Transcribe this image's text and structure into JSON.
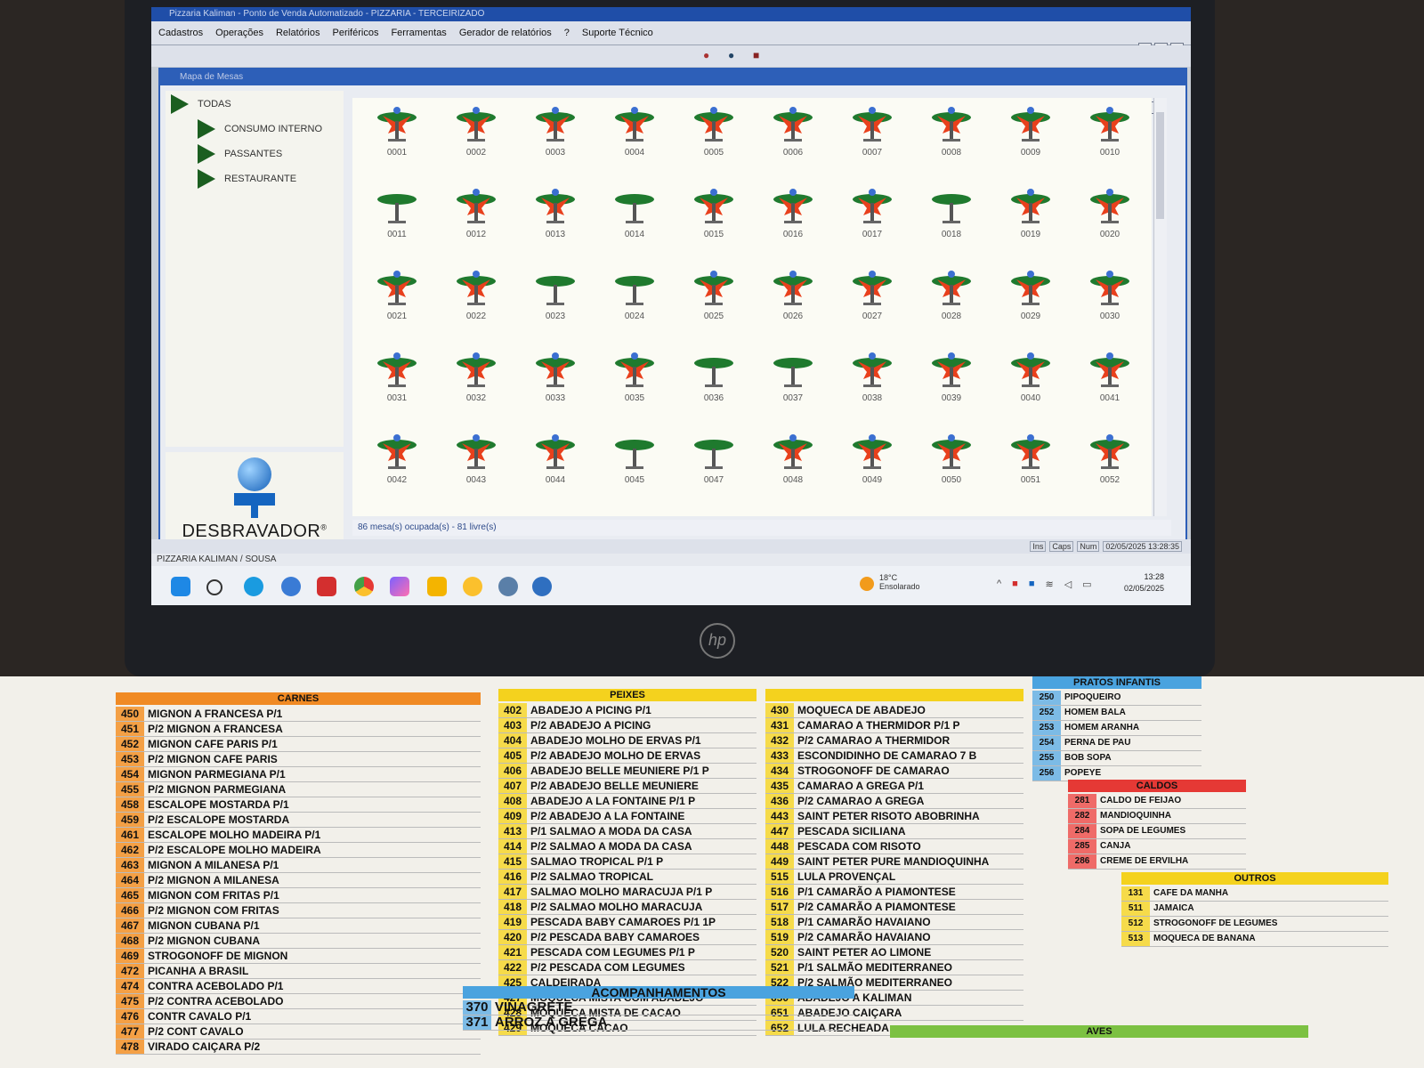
{
  "window": {
    "title": "Pizzaria Kaliman - Ponto de Venda Automatizado - PIZZARIA - TERCEIRIZADO",
    "menu": [
      "Cadastros",
      "Operações",
      "Relatórios",
      "Periféricos",
      "Ferramentas",
      "Gerador de relatórios",
      "?",
      "Suporte Técnico"
    ],
    "controls": [
      "_",
      "□",
      "×"
    ]
  },
  "inner_window": {
    "title": "Mapa de Mesas",
    "controls": [
      "_",
      "□",
      "×"
    ]
  },
  "categories": [
    "TODAS",
    "CONSUMO INTERNO",
    "PASSANTES",
    "RESTAURANTE"
  ],
  "logo": {
    "text": "DESBRAVADOR",
    "mark": "®"
  },
  "tables": [
    {
      "num": "0001",
      "status": "occupied"
    },
    {
      "num": "0002",
      "status": "occupied"
    },
    {
      "num": "0003",
      "status": "occupied"
    },
    {
      "num": "0004",
      "status": "occupied"
    },
    {
      "num": "0005",
      "status": "occupied"
    },
    {
      "num": "0006",
      "status": "occupied"
    },
    {
      "num": "0007",
      "status": "occupied"
    },
    {
      "num": "0008",
      "status": "occupied"
    },
    {
      "num": "0009",
      "status": "occupied"
    },
    {
      "num": "0010",
      "status": "occupied"
    },
    {
      "num": "0011",
      "status": "free"
    },
    {
      "num": "0012",
      "status": "occupied"
    },
    {
      "num": "0013",
      "status": "occupied"
    },
    {
      "num": "0014",
      "status": "free"
    },
    {
      "num": "0015",
      "status": "occupied"
    },
    {
      "num": "0016",
      "status": "occupied"
    },
    {
      "num": "0017",
      "status": "occupied"
    },
    {
      "num": "0018",
      "status": "free"
    },
    {
      "num": "0019",
      "status": "occupied"
    },
    {
      "num": "0020",
      "status": "occupied"
    },
    {
      "num": "0021",
      "status": "occupied"
    },
    {
      "num": "0022",
      "status": "occupied"
    },
    {
      "num": "0023",
      "status": "free"
    },
    {
      "num": "0024",
      "status": "free"
    },
    {
      "num": "0025",
      "status": "occupied"
    },
    {
      "num": "0026",
      "status": "occupied"
    },
    {
      "num": "0027",
      "status": "occupied"
    },
    {
      "num": "0028",
      "status": "occupied"
    },
    {
      "num": "0029",
      "status": "occupied"
    },
    {
      "num": "0030",
      "status": "occupied"
    },
    {
      "num": "0031",
      "status": "occupied"
    },
    {
      "num": "0032",
      "status": "occupied"
    },
    {
      "num": "0033",
      "status": "occupied"
    },
    {
      "num": "0035",
      "status": "occupied"
    },
    {
      "num": "0036",
      "status": "free"
    },
    {
      "num": "0037",
      "status": "free"
    },
    {
      "num": "0038",
      "status": "occupied"
    },
    {
      "num": "0039",
      "status": "occupied"
    },
    {
      "num": "0040",
      "status": "occupied"
    },
    {
      "num": "0041",
      "status": "occupied"
    },
    {
      "num": "0042",
      "status": "occupied"
    },
    {
      "num": "0043",
      "status": "occupied"
    },
    {
      "num": "0044",
      "status": "occupied"
    },
    {
      "num": "0045",
      "status": "free"
    },
    {
      "num": "0047",
      "status": "free"
    },
    {
      "num": "0048",
      "status": "occupied"
    },
    {
      "num": "0049",
      "status": "occupied"
    },
    {
      "num": "0050",
      "status": "occupied"
    },
    {
      "num": "0051",
      "status": "occupied"
    },
    {
      "num": "0052",
      "status": "occupied"
    }
  ],
  "status_bar": "86 mesa(s) ocupada(s) - 81 livre(s)",
  "app_status": {
    "indicators": [
      "Ins",
      "Caps",
      "Num"
    ],
    "datetime": "02/05/2025 13:28:35"
  },
  "footer": "PIZZARIA KALIMAN / SOUSA",
  "taskbar": {
    "weather_temp": "18°C",
    "weather_desc": "Ensolarado",
    "time": "13:28",
    "date": "02/05/2025"
  },
  "laptop_brand": "hp",
  "colors": {
    "occupied": "#e8401c",
    "free": "#1f7a2e",
    "titlebar": "#1f4ea8"
  },
  "menu_card": {
    "carnes": {
      "header": "CARNES",
      "items": [
        {
          "code": "450",
          "name": "MIGNON A FRANCESA P/1"
        },
        {
          "code": "451",
          "name": "P/2 MIGNON A FRANCESA"
        },
        {
          "code": "452",
          "name": "MIGNON CAFE PARIS P/1"
        },
        {
          "code": "453",
          "name": "P/2 MIGNON CAFE PARIS"
        },
        {
          "code": "454",
          "name": "MIGNON PARMEGIANA P/1"
        },
        {
          "code": "455",
          "name": "P/2 MIGNON PARMEGIANA"
        },
        {
          "code": "458",
          "name": "ESCALOPE MOSTARDA P/1"
        },
        {
          "code": "459",
          "name": "P/2 ESCALOPE MOSTARDA"
        },
        {
          "code": "461",
          "name": "ESCALOPE MOLHO MADEIRA P/1"
        },
        {
          "code": "462",
          "name": "P/2 ESCALOPE MOLHO MADEIRA"
        },
        {
          "code": "463",
          "name": "MIGNON A MILANESA P/1"
        },
        {
          "code": "464",
          "name": "P/2 MIGNON A MILANESA"
        },
        {
          "code": "465",
          "name": "MIGNON COM FRITAS P/1"
        },
        {
          "code": "466",
          "name": "P/2 MIGNON COM FRITAS"
        },
        {
          "code": "467",
          "name": "MIGNON CUBANA P/1"
        },
        {
          "code": "468",
          "name": "P/2 MIGNON CUBANA"
        },
        {
          "code": "469",
          "name": "STROGONOFF DE MIGNON"
        },
        {
          "code": "472",
          "name": "PICANHA A BRASIL"
        },
        {
          "code": "474",
          "name": "CONTRA ACEBOLADO P/1"
        },
        {
          "code": "475",
          "name": "P/2 CONTRA ACEBOLADO"
        },
        {
          "code": "476",
          "name": "CONTR CAVALO P/1"
        },
        {
          "code": "477",
          "name": "P/2 CONT CAVALO"
        },
        {
          "code": "478",
          "name": "VIRADO CAIÇARA P/2"
        }
      ]
    },
    "peixes": {
      "header": "PEIXES",
      "left": [
        {
          "code": "402",
          "name": "ABADEJO A PICING P/1"
        },
        {
          "code": "403",
          "name": "P/2 ABADEJO A PICING"
        },
        {
          "code": "404",
          "name": "ABADEJO MOLHO DE ERVAS P/1"
        },
        {
          "code": "405",
          "name": "P/2 ABADEJO MOLHO DE ERVAS"
        },
        {
          "code": "406",
          "name": "ABADEJO BELLE MEUNIERE P/1 P"
        },
        {
          "code": "407",
          "name": "P/2 ABADEJO BELLE MEUNIERE"
        },
        {
          "code": "408",
          "name": "ABADEJO A LA FONTAINE P/1 P"
        },
        {
          "code": "409",
          "name": "P/2 ABADEJO A LA FONTAINE"
        },
        {
          "code": "413",
          "name": "P/1 SALMAO A MODA DA CASA"
        },
        {
          "code": "414",
          "name": "P/2 SALMAO A MODA DA CASA"
        },
        {
          "code": "415",
          "name": "SALMAO TROPICAL P/1 P"
        },
        {
          "code": "416",
          "name": "P/2 SALMAO TROPICAL"
        },
        {
          "code": "417",
          "name": "SALMAO MOLHO MARACUJA P/1 P"
        },
        {
          "code": "418",
          "name": "P/2 SALMAO MOLHO MARACUJA"
        },
        {
          "code": "419",
          "name": "PESCADA BABY CAMAROES P/1 1P"
        },
        {
          "code": "420",
          "name": "P/2 PESCADA BABY CAMAROES"
        },
        {
          "code": "421",
          "name": "PESCADA COM LEGUMES P/1 P"
        },
        {
          "code": "422",
          "name": "P/2 PESCADA COM LEGUMES"
        },
        {
          "code": "425",
          "name": "CALDEIRADA"
        },
        {
          "code": "427",
          "name": "MOQUECA MISTA COM ABADEJO"
        },
        {
          "code": "428",
          "name": "MOQUECA MISTA DE CACAO"
        },
        {
          "code": "429",
          "name": "MOQUECA CACAO"
        }
      ],
      "right": [
        {
          "code": "430",
          "name": "MOQUECA DE ABADEJO"
        },
        {
          "code": "431",
          "name": "CAMARAO A THERMIDOR P/1 P"
        },
        {
          "code": "432",
          "name": "P/2 CAMARAO A THERMIDOR"
        },
        {
          "code": "433",
          "name": "ESCONDIDINHO DE CAMARAO 7 B"
        },
        {
          "code": "434",
          "name": "STROGONOFF DE CAMARAO"
        },
        {
          "code": "435",
          "name": "CAMARAO A GREGA P/1"
        },
        {
          "code": "436",
          "name": "P/2 CAMARAO A GREGA"
        },
        {
          "code": "443",
          "name": "SAINT PETER RISOTO ABOBRINHA"
        },
        {
          "code": "447",
          "name": "PESCADA SICILIANA"
        },
        {
          "code": "448",
          "name": "PESCADA COM RISOTO"
        },
        {
          "code": "449",
          "name": "SAINT PETER PURE MANDIOQUINHA"
        },
        {
          "code": "515",
          "name": "LULA PROVENÇAL"
        },
        {
          "code": "516",
          "name": "P/1 CAMARÃO A PIAMONTESE"
        },
        {
          "code": "517",
          "name": "P/2 CAMARÃO A PIAMONTESE"
        },
        {
          "code": "518",
          "name": "P/1 CAMARÃO HAVAIANO"
        },
        {
          "code": "519",
          "name": "P/2 CAMARÃO HAVAIANO"
        },
        {
          "code": "520",
          "name": "SAINT PETER AO LIMONE"
        },
        {
          "code": "521",
          "name": "P/1 SALMÃO MEDITERRANEO"
        },
        {
          "code": "522",
          "name": "P/2 SALMÃO MEDITERRANEO"
        },
        {
          "code": "650",
          "name": "ABADEJO A KALIMAN"
        },
        {
          "code": "651",
          "name": "ABADEJO CAIÇARA"
        },
        {
          "code": "652",
          "name": "LULA RECHEADA"
        }
      ]
    },
    "pratos_infantis": {
      "header": "PRATOS INFANTIS",
      "items": [
        {
          "code": "250",
          "name": "PIPOQUEIRO"
        },
        {
          "code": "252",
          "name": "HOMEM BALA"
        },
        {
          "code": "253",
          "name": "HOMEM ARANHA"
        },
        {
          "code": "254",
          "name": "PERNA DE PAU"
        },
        {
          "code": "255",
          "name": "BOB SOPA"
        },
        {
          "code": "256",
          "name": "POPEYE"
        }
      ]
    },
    "caldos": {
      "header": "CALDOS",
      "items": [
        {
          "code": "281",
          "name": "CALDO DE FEIJAO"
        },
        {
          "code": "282",
          "name": "MANDIOQUINHA"
        },
        {
          "code": "284",
          "name": "SOPA DE LEGUMES"
        },
        {
          "code": "285",
          "name": "CANJA"
        },
        {
          "code": "286",
          "name": "CREME DE ERVILHA"
        }
      ]
    },
    "outros": {
      "header": "OUTROS",
      "items": [
        {
          "code": "131",
          "name": "CAFE DA MANHA"
        },
        {
          "code": "511",
          "name": "JAMAICA"
        },
        {
          "code": "512",
          "name": "STROGONOFF DE LEGUMES"
        },
        {
          "code": "513",
          "name": "MOQUECA DE BANANA"
        }
      ]
    },
    "acompanhamentos": {
      "header": "ACOMPANHAMENTOS",
      "items": [
        {
          "code": "370",
          "name": "VINAGRETE"
        },
        {
          "code": "371",
          "name": "ARROZ A GREGA"
        }
      ]
    },
    "aves": {
      "header": "AVES"
    }
  }
}
